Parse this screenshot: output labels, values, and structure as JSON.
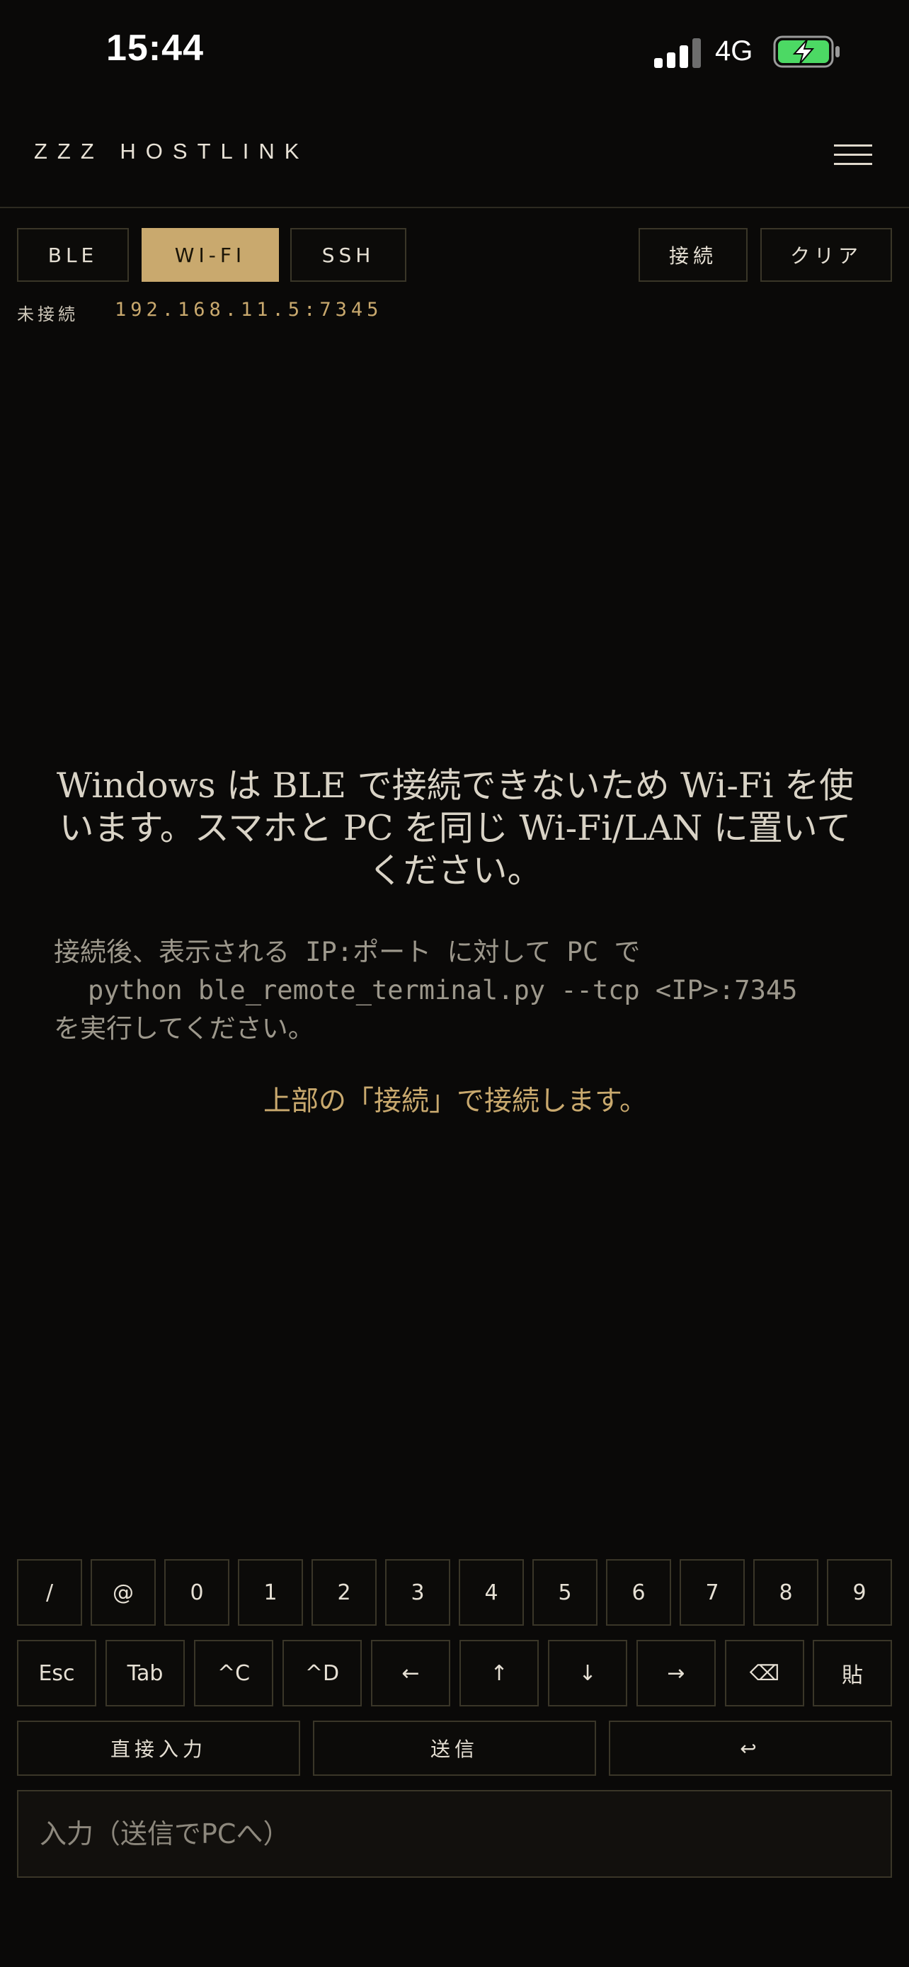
{
  "status_bar": {
    "time": "15:44",
    "network": "4G"
  },
  "header": {
    "title": "ZZZ HOSTLINK"
  },
  "modes": [
    "BLE",
    "WI-FI",
    "SSH"
  ],
  "active_mode": "WI-FI",
  "actions": {
    "connect": "接続",
    "clear": "クリア"
  },
  "connection": {
    "status": "未接続",
    "address": "192.168.11.5:7345"
  },
  "message": {
    "main": "Windows は BLE で接続できないため Wi-Fi を使います。スマホと PC を同じ Wi-Fi/LAN に置いてください。",
    "sub_line1": "接続後、表示される IP:ポート に対して PC で",
    "sub_line2": "python ble_remote_terminal.py --tcp <IP>:7345",
    "sub_line3": "を実行してください。",
    "hint": "上部の「接続」で接続します。"
  },
  "keypad": {
    "row1": [
      "/",
      "@",
      "0",
      "1",
      "2",
      "3",
      "4",
      "5",
      "6",
      "7",
      "8",
      "9"
    ],
    "row2": [
      "Esc",
      "Tab",
      "^C",
      "^D",
      "←",
      "↑",
      "↓",
      "→",
      "⌫",
      "貼"
    ],
    "row3": [
      "直接入力",
      "送信",
      "↩"
    ]
  },
  "input": {
    "placeholder": "入力（送信でPCへ）"
  },
  "colors": {
    "accent": "#c9a96e",
    "background": "#0a0908",
    "border": "#3a3628",
    "battery": "#4cd964"
  }
}
